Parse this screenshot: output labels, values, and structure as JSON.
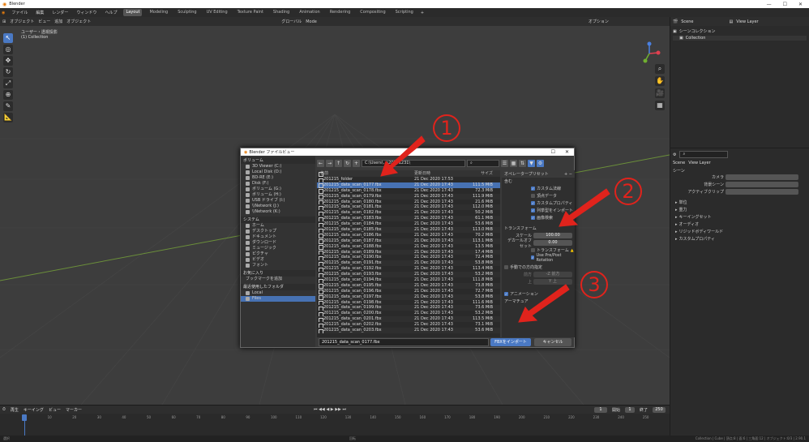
{
  "window": {
    "title": "Blender",
    "controls": [
      "—",
      "☐",
      "✕"
    ]
  },
  "menubar": {
    "items": [
      "ファイル",
      "編集",
      "レンダー",
      "ウィンドウ",
      "ヘルプ"
    ],
    "workspaces": [
      "Layout",
      "Modeling",
      "Sculpting",
      "UV Editing",
      "Texture Paint",
      "Shading",
      "Animation",
      "Rendering",
      "Compositing",
      "Scripting"
    ],
    "active_workspace": "Layout"
  },
  "viewport": {
    "mode": "オブジェクト",
    "header_menus": [
      "ビュー",
      "追加",
      "オブジェクト"
    ],
    "overlay_text_1": "ユーザー・透視投影",
    "overlay_text_2": "(1) Collection",
    "transform": "グローバル",
    "options": "オプション",
    "mode_center": "Mode"
  },
  "right_panel": {
    "scene": "Scene",
    "view_layer": "View Layer",
    "outliner_root": "シーンコレクション",
    "outliner_child": "Collection",
    "props_header": "シーン",
    "props_fields": [
      "カメラ",
      "背景シーン",
      "アクティブクリップ"
    ],
    "props_sections": [
      "単位",
      "重力",
      "キーイングセット",
      "オーディオ",
      "リジッドボディワールド",
      "カスタムプロパティ"
    ],
    "search_tag": "Scene",
    "breadcrumb_view": "View Layer"
  },
  "timeline": {
    "menus": [
      "再生",
      "キーイング",
      "ビュー",
      "マーカー"
    ],
    "start_label": "開始",
    "start": "1",
    "end_label": "終了",
    "end": "250",
    "current": "1",
    "ticks": [
      "0",
      "10",
      "20",
      "30",
      "40",
      "50",
      "60",
      "70",
      "80",
      "90",
      "100",
      "110",
      "120",
      "130",
      "140",
      "150",
      "160",
      "170",
      "180",
      "190",
      "200",
      "210",
      "220",
      "230",
      "240",
      "250"
    ]
  },
  "status": {
    "left": "選択",
    "middle": "回転",
    "right": "Collection | Cube | 頂点:8 | 面:6 | 三角面:12 | オブジェクト:0/3 | 2.90.1"
  },
  "dialog": {
    "title": "Blender ファイルビュー",
    "path": "C:\\Users\\...\\20201231\\",
    "sidebar": {
      "volumes_header": "ボリューム",
      "volumes": [
        "3D Viewer (C:)",
        "Local Disk (D:)",
        "BD-RE (E:)",
        "Disk (F:)",
        "ボリューム (G:)",
        "ボリューム (H:)",
        "USB ドライブ (I:)",
        "\\\\Network (J:)",
        "\\\\Network (K:)"
      ],
      "system_header": "システム",
      "system": [
        "ホーム",
        "デスクトップ",
        "ドキュメント",
        "ダウンロード",
        "ミュージック",
        "ピクチャ",
        "ビデオ",
        "フォント"
      ],
      "bookmarks_header": "お気に入り",
      "bookmark_add": "ブックマークを追加",
      "recent_header": "最近使用したフォルダ",
      "recent": [
        "Local",
        "Files"
      ]
    },
    "columns": {
      "name": "名前",
      "date": "更新日時",
      "size": "サイズ"
    },
    "files": [
      {
        "name": "201215_folder",
        "date": "21 Dec 2020 17:53",
        "size": ""
      },
      {
        "name": "201215_data_scan_0177.fbx",
        "date": "21 Dec 2020 17:43",
        "size": "111.5 MiB"
      },
      {
        "name": "201215_data_scan_0178.fbx",
        "date": "21 Dec 2020 17:43",
        "size": "72.3 MiB"
      },
      {
        "name": "201215_data_scan_0179.fbx",
        "date": "21 Dec 2020 17:43",
        "size": "111.9 MiB"
      },
      {
        "name": "201215_data_scan_0180.fbx",
        "date": "21 Dec 2020 17:43",
        "size": "21.6 MiB"
      },
      {
        "name": "201215_data_scan_0181.fbx",
        "date": "21 Dec 2020 17:43",
        "size": "112.0 MiB"
      },
      {
        "name": "201215_data_scan_0182.fbx",
        "date": "21 Dec 2020 17:43",
        "size": "50.2 MiB"
      },
      {
        "name": "201215_data_scan_0183.fbx",
        "date": "21 Dec 2020 17:43",
        "size": "61.1 MiB"
      },
      {
        "name": "201215_data_scan_0184.fbx",
        "date": "21 Dec 2020 17:43",
        "size": "53.6 MiB"
      },
      {
        "name": "201215_data_scan_0185.fbx",
        "date": "21 Dec 2020 17:43",
        "size": "113.0 MiB"
      },
      {
        "name": "201215_data_scan_0186.fbx",
        "date": "21 Dec 2020 17:43",
        "size": "70.2 MiB"
      },
      {
        "name": "201215_data_scan_0187.fbx",
        "date": "21 Dec 2020 17:43",
        "size": "113.1 MiB"
      },
      {
        "name": "201215_data_scan_0188.fbx",
        "date": "21 Dec 2020 17:43",
        "size": "13.5 MiB"
      },
      {
        "name": "201215_data_scan_0189.fbx",
        "date": "21 Dec 2020 17:43",
        "size": "17.4 MiB"
      },
      {
        "name": "201215_data_scan_0190.fbx",
        "date": "21 Dec 2020 17:43",
        "size": "72.4 MiB"
      },
      {
        "name": "201215_data_scan_0191.fbx",
        "date": "21 Dec 2020 17:43",
        "size": "53.8 MiB"
      },
      {
        "name": "201215_data_scan_0192.fbx",
        "date": "21 Dec 2020 17:43",
        "size": "113.4 MiB"
      },
      {
        "name": "201215_data_scan_0193.fbx",
        "date": "21 Dec 2020 17:43",
        "size": "53.2 MiB"
      },
      {
        "name": "201215_data_scan_0194.fbx",
        "date": "21 Dec 2020 17:43",
        "size": "111.8 MiB"
      },
      {
        "name": "201215_data_scan_0195.fbx",
        "date": "21 Dec 2020 17:43",
        "size": "73.8 MiB"
      },
      {
        "name": "201215_data_scan_0196.fbx",
        "date": "21 Dec 2020 17:43",
        "size": "72.7 MiB"
      },
      {
        "name": "201215_data_scan_0197.fbx",
        "date": "21 Dec 2020 17:43",
        "size": "53.8 MiB"
      },
      {
        "name": "201215_data_scan_0198.fbx",
        "date": "21 Dec 2020 17:43",
        "size": "111.6 MiB"
      },
      {
        "name": "201215_data_scan_0199.fbx",
        "date": "21 Dec 2020 17:43",
        "size": "73.6 MiB"
      },
      {
        "name": "201215_data_scan_0200.fbx",
        "date": "21 Dec 2020 17:43",
        "size": "53.2 MiB"
      },
      {
        "name": "201215_data_scan_0201.fbx",
        "date": "21 Dec 2020 17:43",
        "size": "113.5 MiB"
      },
      {
        "name": "201215_data_scan_0202.fbx",
        "date": "21 Dec 2020 17:43",
        "size": "73.1 MiB"
      },
      {
        "name": "201215_data_scan_0203.fbx",
        "date": "21 Dec 2020 17:43",
        "size": "53.6 MiB"
      }
    ],
    "selected_index": 1,
    "props": {
      "preset_label": "オペレータープリセット",
      "include_header": "含む",
      "include_items": [
        {
          "label": "カスタム法線",
          "checked": true
        },
        {
          "label": "頂点データ",
          "checked": false
        },
        {
          "label": "カスタムプロパティ",
          "checked": true
        },
        {
          "label": "列挙型をインポート",
          "checked": true
        },
        {
          "label": "画像検索",
          "checked": true
        }
      ],
      "transform_header": "トランスフォーム",
      "scale_label": "スケール",
      "scale_value": "100.00",
      "decal_label": "デカールオフセット",
      "decal_value": "0.00",
      "apply_transform": "トランスフォーム",
      "apply_transform_checked": false,
      "axis_label": "Use Pre/Post Rotation",
      "axis_checked": true,
      "manual_header": "手動での方向指定",
      "forward_label": "前方",
      "forward_value": "-Z 前方",
      "up_label": "上",
      "up_value": "Y 上",
      "animation_header": "アニメーション",
      "armature_header": "アーマチュア"
    },
    "filename": "201215_data_scan_0177.fbx",
    "import_label": "FBXをインポート",
    "cancel_label": "キャンセル"
  },
  "annotations": [
    "1",
    "2",
    "3"
  ],
  "colors": {
    "accent": "#4a79c4",
    "annotation": "#e0231c",
    "selection": "#4772b3"
  }
}
